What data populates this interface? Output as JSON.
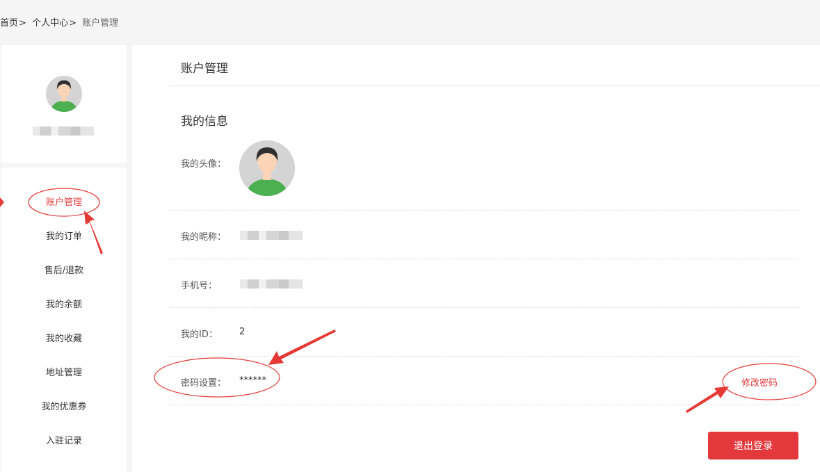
{
  "breadcrumb": {
    "home": "首页",
    "center": "个人中心",
    "current": "账户管理",
    "separator": ">"
  },
  "menu": {
    "items": [
      {
        "label": "账户管理",
        "active": true
      },
      {
        "label": "我的订单"
      },
      {
        "label": "售后/退款"
      },
      {
        "label": "我的余额"
      },
      {
        "label": "我的收藏"
      },
      {
        "label": "地址管理"
      },
      {
        "label": "我的优惠券"
      },
      {
        "label": "入驻记录"
      }
    ]
  },
  "main": {
    "title": "账户管理",
    "section_title": "我的信息",
    "rows": {
      "avatar_label": "我的头像：",
      "nickname_label": "我的昵称：",
      "phone_label": "手机号：",
      "id_label": "我的ID：",
      "id_value": "2",
      "password_label": "密码设置：",
      "password_value": "******"
    },
    "change_password": "修改密码",
    "logout": "退出登录"
  },
  "colors": {
    "accent": "#e4393c",
    "annotation": "#e53935",
    "avatar_bg": "#d4d4d4",
    "shirt": "#4caf50"
  },
  "icons": {
    "avatar": "user-avatar-icon",
    "menu_marker": "caret-right-icon"
  }
}
